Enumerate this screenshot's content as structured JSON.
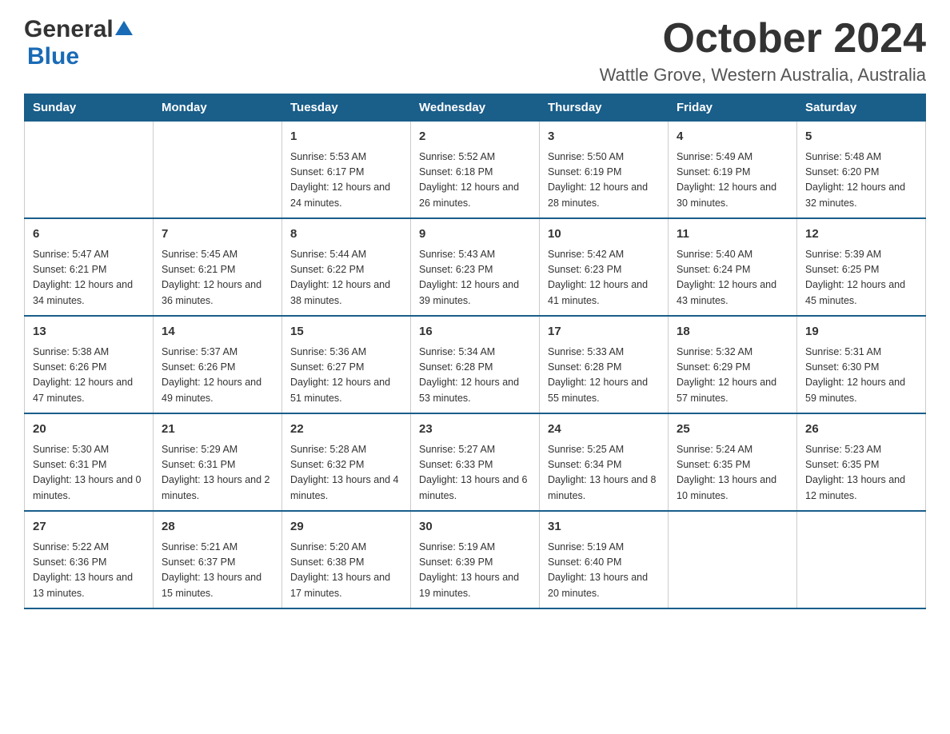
{
  "header": {
    "logo": {
      "general": "General",
      "blue": "Blue"
    },
    "title": "October 2024",
    "location": "Wattle Grove, Western Australia, Australia"
  },
  "calendar": {
    "days_of_week": [
      "Sunday",
      "Monday",
      "Tuesday",
      "Wednesday",
      "Thursday",
      "Friday",
      "Saturday"
    ],
    "weeks": [
      [
        {
          "day": "",
          "sunrise": "",
          "sunset": "",
          "daylight": ""
        },
        {
          "day": "",
          "sunrise": "",
          "sunset": "",
          "daylight": ""
        },
        {
          "day": "1",
          "sunrise": "Sunrise: 5:53 AM",
          "sunset": "Sunset: 6:17 PM",
          "daylight": "Daylight: 12 hours and 24 minutes."
        },
        {
          "day": "2",
          "sunrise": "Sunrise: 5:52 AM",
          "sunset": "Sunset: 6:18 PM",
          "daylight": "Daylight: 12 hours and 26 minutes."
        },
        {
          "day": "3",
          "sunrise": "Sunrise: 5:50 AM",
          "sunset": "Sunset: 6:19 PM",
          "daylight": "Daylight: 12 hours and 28 minutes."
        },
        {
          "day": "4",
          "sunrise": "Sunrise: 5:49 AM",
          "sunset": "Sunset: 6:19 PM",
          "daylight": "Daylight: 12 hours and 30 minutes."
        },
        {
          "day": "5",
          "sunrise": "Sunrise: 5:48 AM",
          "sunset": "Sunset: 6:20 PM",
          "daylight": "Daylight: 12 hours and 32 minutes."
        }
      ],
      [
        {
          "day": "6",
          "sunrise": "Sunrise: 5:47 AM",
          "sunset": "Sunset: 6:21 PM",
          "daylight": "Daylight: 12 hours and 34 minutes."
        },
        {
          "day": "7",
          "sunrise": "Sunrise: 5:45 AM",
          "sunset": "Sunset: 6:21 PM",
          "daylight": "Daylight: 12 hours and 36 minutes."
        },
        {
          "day": "8",
          "sunrise": "Sunrise: 5:44 AM",
          "sunset": "Sunset: 6:22 PM",
          "daylight": "Daylight: 12 hours and 38 minutes."
        },
        {
          "day": "9",
          "sunrise": "Sunrise: 5:43 AM",
          "sunset": "Sunset: 6:23 PM",
          "daylight": "Daylight: 12 hours and 39 minutes."
        },
        {
          "day": "10",
          "sunrise": "Sunrise: 5:42 AM",
          "sunset": "Sunset: 6:23 PM",
          "daylight": "Daylight: 12 hours and 41 minutes."
        },
        {
          "day": "11",
          "sunrise": "Sunrise: 5:40 AM",
          "sunset": "Sunset: 6:24 PM",
          "daylight": "Daylight: 12 hours and 43 minutes."
        },
        {
          "day": "12",
          "sunrise": "Sunrise: 5:39 AM",
          "sunset": "Sunset: 6:25 PM",
          "daylight": "Daylight: 12 hours and 45 minutes."
        }
      ],
      [
        {
          "day": "13",
          "sunrise": "Sunrise: 5:38 AM",
          "sunset": "Sunset: 6:26 PM",
          "daylight": "Daylight: 12 hours and 47 minutes."
        },
        {
          "day": "14",
          "sunrise": "Sunrise: 5:37 AM",
          "sunset": "Sunset: 6:26 PM",
          "daylight": "Daylight: 12 hours and 49 minutes."
        },
        {
          "day": "15",
          "sunrise": "Sunrise: 5:36 AM",
          "sunset": "Sunset: 6:27 PM",
          "daylight": "Daylight: 12 hours and 51 minutes."
        },
        {
          "day": "16",
          "sunrise": "Sunrise: 5:34 AM",
          "sunset": "Sunset: 6:28 PM",
          "daylight": "Daylight: 12 hours and 53 minutes."
        },
        {
          "day": "17",
          "sunrise": "Sunrise: 5:33 AM",
          "sunset": "Sunset: 6:28 PM",
          "daylight": "Daylight: 12 hours and 55 minutes."
        },
        {
          "day": "18",
          "sunrise": "Sunrise: 5:32 AM",
          "sunset": "Sunset: 6:29 PM",
          "daylight": "Daylight: 12 hours and 57 minutes."
        },
        {
          "day": "19",
          "sunrise": "Sunrise: 5:31 AM",
          "sunset": "Sunset: 6:30 PM",
          "daylight": "Daylight: 12 hours and 59 minutes."
        }
      ],
      [
        {
          "day": "20",
          "sunrise": "Sunrise: 5:30 AM",
          "sunset": "Sunset: 6:31 PM",
          "daylight": "Daylight: 13 hours and 0 minutes."
        },
        {
          "day": "21",
          "sunrise": "Sunrise: 5:29 AM",
          "sunset": "Sunset: 6:31 PM",
          "daylight": "Daylight: 13 hours and 2 minutes."
        },
        {
          "day": "22",
          "sunrise": "Sunrise: 5:28 AM",
          "sunset": "Sunset: 6:32 PM",
          "daylight": "Daylight: 13 hours and 4 minutes."
        },
        {
          "day": "23",
          "sunrise": "Sunrise: 5:27 AM",
          "sunset": "Sunset: 6:33 PM",
          "daylight": "Daylight: 13 hours and 6 minutes."
        },
        {
          "day": "24",
          "sunrise": "Sunrise: 5:25 AM",
          "sunset": "Sunset: 6:34 PM",
          "daylight": "Daylight: 13 hours and 8 minutes."
        },
        {
          "day": "25",
          "sunrise": "Sunrise: 5:24 AM",
          "sunset": "Sunset: 6:35 PM",
          "daylight": "Daylight: 13 hours and 10 minutes."
        },
        {
          "day": "26",
          "sunrise": "Sunrise: 5:23 AM",
          "sunset": "Sunset: 6:35 PM",
          "daylight": "Daylight: 13 hours and 12 minutes."
        }
      ],
      [
        {
          "day": "27",
          "sunrise": "Sunrise: 5:22 AM",
          "sunset": "Sunset: 6:36 PM",
          "daylight": "Daylight: 13 hours and 13 minutes."
        },
        {
          "day": "28",
          "sunrise": "Sunrise: 5:21 AM",
          "sunset": "Sunset: 6:37 PM",
          "daylight": "Daylight: 13 hours and 15 minutes."
        },
        {
          "day": "29",
          "sunrise": "Sunrise: 5:20 AM",
          "sunset": "Sunset: 6:38 PM",
          "daylight": "Daylight: 13 hours and 17 minutes."
        },
        {
          "day": "30",
          "sunrise": "Sunrise: 5:19 AM",
          "sunset": "Sunset: 6:39 PM",
          "daylight": "Daylight: 13 hours and 19 minutes."
        },
        {
          "day": "31",
          "sunrise": "Sunrise: 5:19 AM",
          "sunset": "Sunset: 6:40 PM",
          "daylight": "Daylight: 13 hours and 20 minutes."
        },
        {
          "day": "",
          "sunrise": "",
          "sunset": "",
          "daylight": ""
        },
        {
          "day": "",
          "sunrise": "",
          "sunset": "",
          "daylight": ""
        }
      ]
    ]
  }
}
